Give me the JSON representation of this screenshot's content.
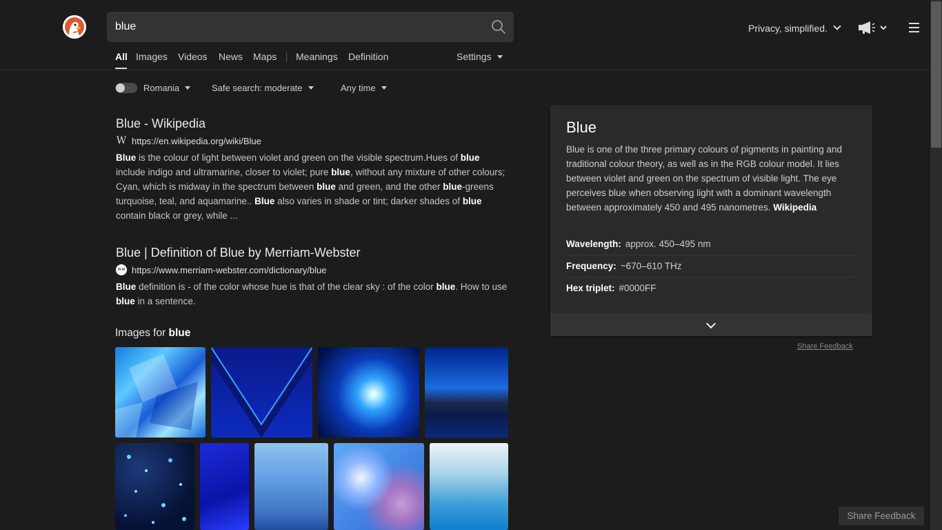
{
  "search": {
    "query": "blue"
  },
  "nav": {
    "tabs": [
      {
        "label": "All"
      },
      {
        "label": "Images"
      },
      {
        "label": "Videos"
      },
      {
        "label": "News"
      },
      {
        "label": "Maps"
      },
      {
        "label": "Meanings"
      },
      {
        "label": "Definition"
      }
    ],
    "settings_label": "Settings"
  },
  "header": {
    "tagline": "Privacy, simplified."
  },
  "filters": {
    "region": "Romania",
    "safe_search": "Safe search: moderate",
    "time": "Any time"
  },
  "results": [
    {
      "title": "Blue - Wikipedia",
      "url": "https://en.wikipedia.org/wiki/Blue",
      "favicon_text": "W",
      "snippet": [
        {
          "t": "Blue",
          "b": true
        },
        {
          "t": " is the colour of light between violet and green on the visible spectrum.Hues of "
        },
        {
          "t": "blue",
          "b": true
        },
        {
          "t": " include indigo and ultramarine, closer to violet; pure "
        },
        {
          "t": "blue",
          "b": true
        },
        {
          "t": ", without any mixture of other colours; Cyan, which is midway in the spectrum between "
        },
        {
          "t": "blue",
          "b": true
        },
        {
          "t": " and green, and the other "
        },
        {
          "t": "blue",
          "b": true
        },
        {
          "t": "-greens turquoise, teal, and aquamarine.. "
        },
        {
          "t": "Blue",
          "b": true
        },
        {
          "t": " also varies in shade or tint; darker shades of "
        },
        {
          "t": "blue",
          "b": true
        },
        {
          "t": " contain black or grey, while ..."
        }
      ]
    },
    {
      "title": "Blue | Definition of Blue by Merriam-Webster",
      "url": "https://www.merriam-webster.com/dictionary/blue",
      "favicon_text": "M-W",
      "snippet": [
        {
          "t": "Blue",
          "b": true
        },
        {
          "t": " definition is - of the color whose hue is that of the clear sky : of the color "
        },
        {
          "t": "blue",
          "b": true
        },
        {
          "t": ". How to use "
        },
        {
          "t": "blue",
          "b": true
        },
        {
          "t": " in a sentence."
        }
      ]
    }
  ],
  "images": {
    "title_prefix": "Images for ",
    "title_query": "blue",
    "tiles": [
      {
        "name": "blue-shards-image"
      },
      {
        "name": "blue-chevron-image"
      },
      {
        "name": "blue-burst-image"
      },
      {
        "name": "blue-lake-dusk-image"
      },
      {
        "name": "blue-bubbles-image"
      },
      {
        "name": "blue-abstract-image"
      },
      {
        "name": "blue-sky-mist-image"
      },
      {
        "name": "blue-pink-clouds-image"
      },
      {
        "name": "blue-gradient-image"
      }
    ]
  },
  "infobox": {
    "title": "Blue",
    "abstract": "Blue is one of the three primary colours of pigments in painting and traditional colour theory, as well as in the RGB colour model. It lies between violet and green on the spectrum of visible light. The eye perceives blue when observing light with a dominant wavelength between approximately 450 and 495 nanometres.",
    "source": "Wikipedia",
    "rows": [
      {
        "label": "Wavelength:",
        "value": "approx. 450–495 nm"
      },
      {
        "label": "Frequency:",
        "value": "~670–610 THz"
      },
      {
        "label": "Hex triplet:",
        "value": "#0000FF"
      }
    ]
  },
  "feedback": {
    "link_label": "Share Feedback",
    "button_label": "Share Feedback"
  },
  "colors": {
    "background": "#1c1c1c",
    "panel": "#2a2a2a",
    "search_box": "#333333"
  },
  "icons": [
    "duckduckgo-logo",
    "search-icon",
    "megaphone-icon",
    "hamburger-menu-icon",
    "chevron-down-icon"
  ]
}
